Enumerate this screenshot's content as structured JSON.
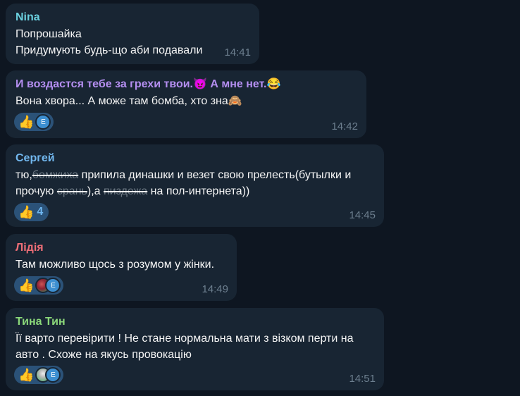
{
  "colors": {
    "background": "#0e1621",
    "bubble": "#182533",
    "reaction_pill": "#2b5278",
    "time": "#6d7f8f",
    "sender_nina": "#6bd1e0",
    "sender_purple": "#b48ef0",
    "sender_sergey": "#72b8ef",
    "sender_lidiya": "#ee6e77",
    "sender_tina": "#8bd87a"
  },
  "messages": [
    {
      "sender": "Nina",
      "lines": [
        "Попрошайка",
        "Придумують будь-що аби подавали"
      ],
      "time": "14:41"
    },
    {
      "sender": "И воздастся тебе за грехи твои.😈 А мне нет.😂",
      "lines": [
        "Вона хвора... А може там бомба, хто зна🙈"
      ],
      "reaction_avatar": "E",
      "time": "14:42"
    },
    {
      "sender": "Сергей",
      "line1": {
        "a": "тю,",
        "strike": "бомжиха",
        "b": " припила динашки и везет свою прелесть(бутылки и"
      },
      "line2": {
        "a": "прочую ",
        "strike1": "срань",
        "b": "),а ",
        "strike2": "пиздежа",
        "c": " на пол-интернета))"
      },
      "reaction_count": "4",
      "time": "14:45"
    },
    {
      "sender": "Лідія",
      "lines": [
        "Там можливо щось з розумом у жінки."
      ],
      "reaction_avatar": "E",
      "time": "14:49"
    },
    {
      "sender": "Тина Тин",
      "lines": [
        "Її варто перевірити ! Не стане нормальна мати з візком перти на",
        "авто . Схоже на якусь провокацію"
      ],
      "reaction_avatar": "E",
      "time": "14:51"
    }
  ],
  "reaction_emoji": "👍"
}
